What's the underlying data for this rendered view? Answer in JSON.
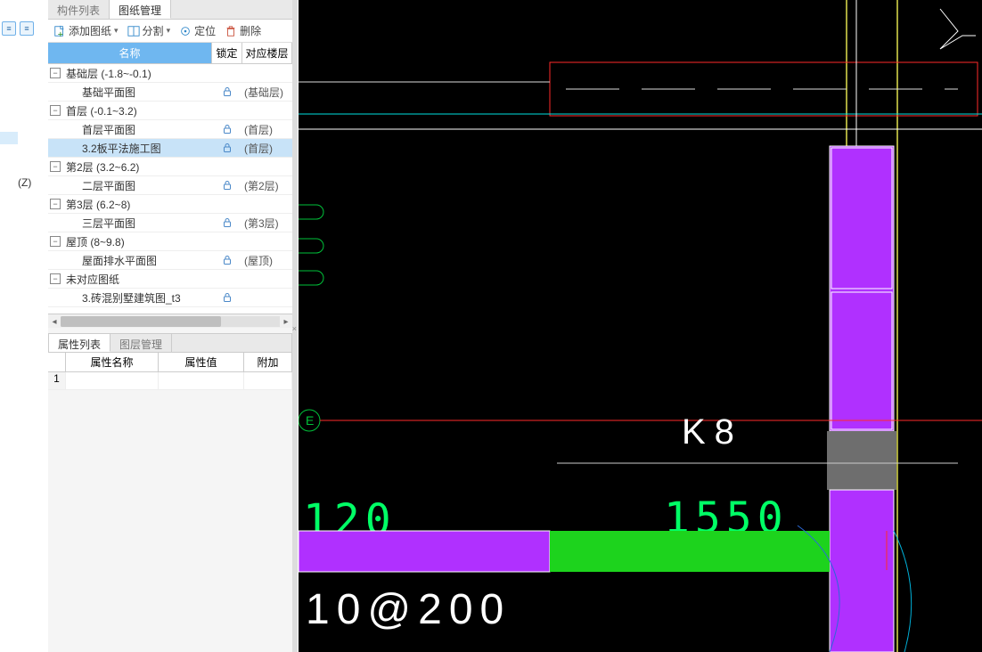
{
  "left_strip": {
    "z_label": "(Z)"
  },
  "tabs_top": {
    "t1": "构件列表",
    "t2": "图纸管理"
  },
  "toolbar": {
    "add": "添加图纸",
    "split": "分割",
    "locate": "定位",
    "delete": "删除"
  },
  "tree_header": {
    "name": "名称",
    "lock": "锁定",
    "floor": "对应楼层"
  },
  "tree": [
    {
      "type": "group",
      "label": "基础层 (-1.8~-0.1)"
    },
    {
      "type": "item",
      "label": "基础平面图",
      "floor": "(基础层)"
    },
    {
      "type": "group",
      "label": "首层 (-0.1~3.2)"
    },
    {
      "type": "item",
      "label": "首层平面图",
      "floor": "(首层)"
    },
    {
      "type": "item",
      "label": "3.2板平法施工图",
      "floor": "(首层)",
      "selected": true
    },
    {
      "type": "group",
      "label": "第2层 (3.2~6.2)"
    },
    {
      "type": "item",
      "label": "二层平面图",
      "floor": "(第2层)"
    },
    {
      "type": "group",
      "label": "第3层 (6.2~8)"
    },
    {
      "type": "item",
      "label": "三层平面图",
      "floor": "(第3层)"
    },
    {
      "type": "group",
      "label": "屋顶 (8~9.8)"
    },
    {
      "type": "item",
      "label": "屋面排水平面图",
      "floor": "(屋顶)"
    },
    {
      "type": "group",
      "label": "未对应图纸"
    },
    {
      "type": "item",
      "label": "3.砖混别墅建筑图_t3",
      "floor": ""
    }
  ],
  "tabs_bottom": {
    "t1": "属性列表",
    "t2": "图层管理"
  },
  "prop_header": {
    "idx": "",
    "name": "属性名称",
    "value": "属性值",
    "extra": "附加"
  },
  "prop_rows": [
    {
      "idx": "1",
      "name": "",
      "value": "",
      "extra": ""
    }
  ],
  "cad": {
    "axis_label_E": "E",
    "label_K8": "K8",
    "dim_120": "120",
    "dim_1550": "1550",
    "rebar": "10@200"
  }
}
